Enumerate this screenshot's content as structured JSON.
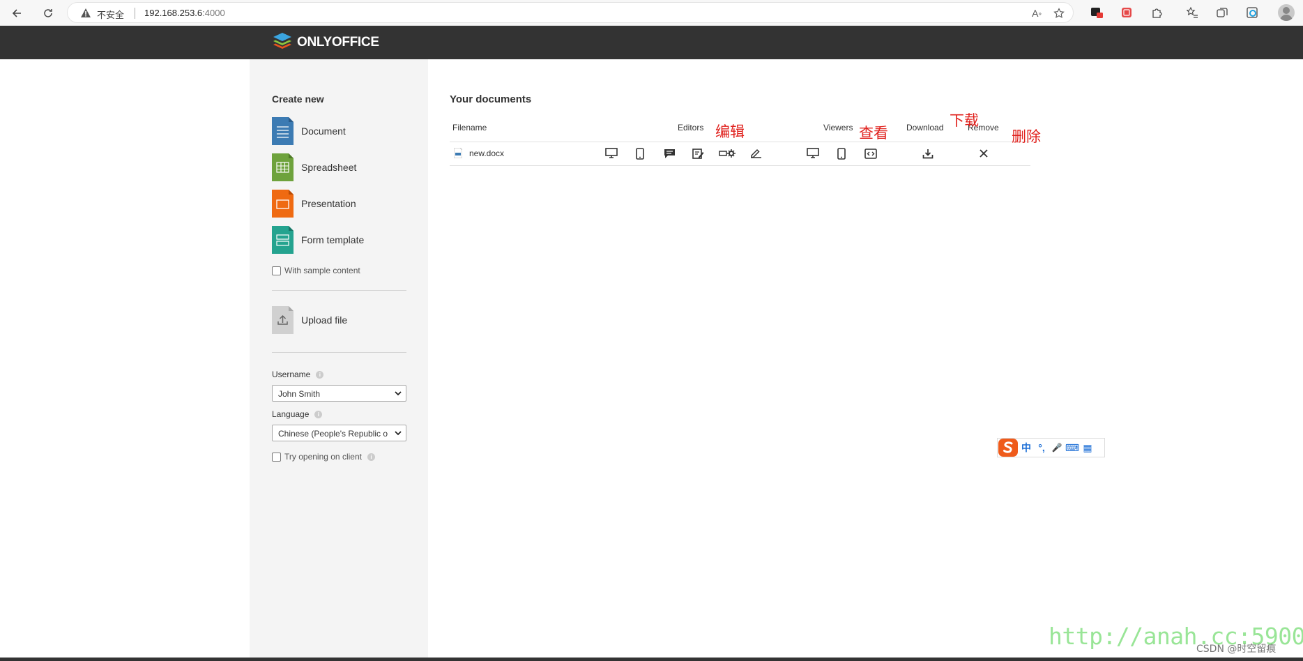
{
  "browser": {
    "insecure_label": "不安全",
    "url_host": "192.168.253.6",
    "url_port": ":4000"
  },
  "header": {
    "logo_text": "ONLYOFFICE"
  },
  "sidebar": {
    "create_title": "Create new",
    "items": [
      {
        "label": "Document",
        "color": "#3c7bb3"
      },
      {
        "label": "Spreadsheet",
        "color": "#6ea23c"
      },
      {
        "label": "Presentation",
        "color": "#ef6a12"
      },
      {
        "label": "Form template",
        "color": "#24a38f"
      }
    ],
    "sample_label": "With sample content",
    "upload_label": "Upload file",
    "username_label": "Username",
    "username_value": "John Smith",
    "language_label": "Language",
    "language_value": "Chinese (People's Republic o",
    "try_client_label": "Try opening on client"
  },
  "main": {
    "title": "Your documents",
    "columns": {
      "filename": "Filename",
      "editors": "Editors",
      "viewers": "Viewers",
      "download": "Download",
      "remove": "Remove"
    },
    "files": [
      {
        "name": "new.docx"
      }
    ]
  },
  "annotations": {
    "edit": "编辑",
    "view": "查看",
    "download": "下载",
    "delete": "删除"
  },
  "ime": {
    "items": [
      "中",
      "°,",
      "🎤",
      "⌨",
      "▦"
    ]
  },
  "watermark": {
    "url": "http://anah.cc:5900",
    "credit": "CSDN @时空留痕"
  }
}
